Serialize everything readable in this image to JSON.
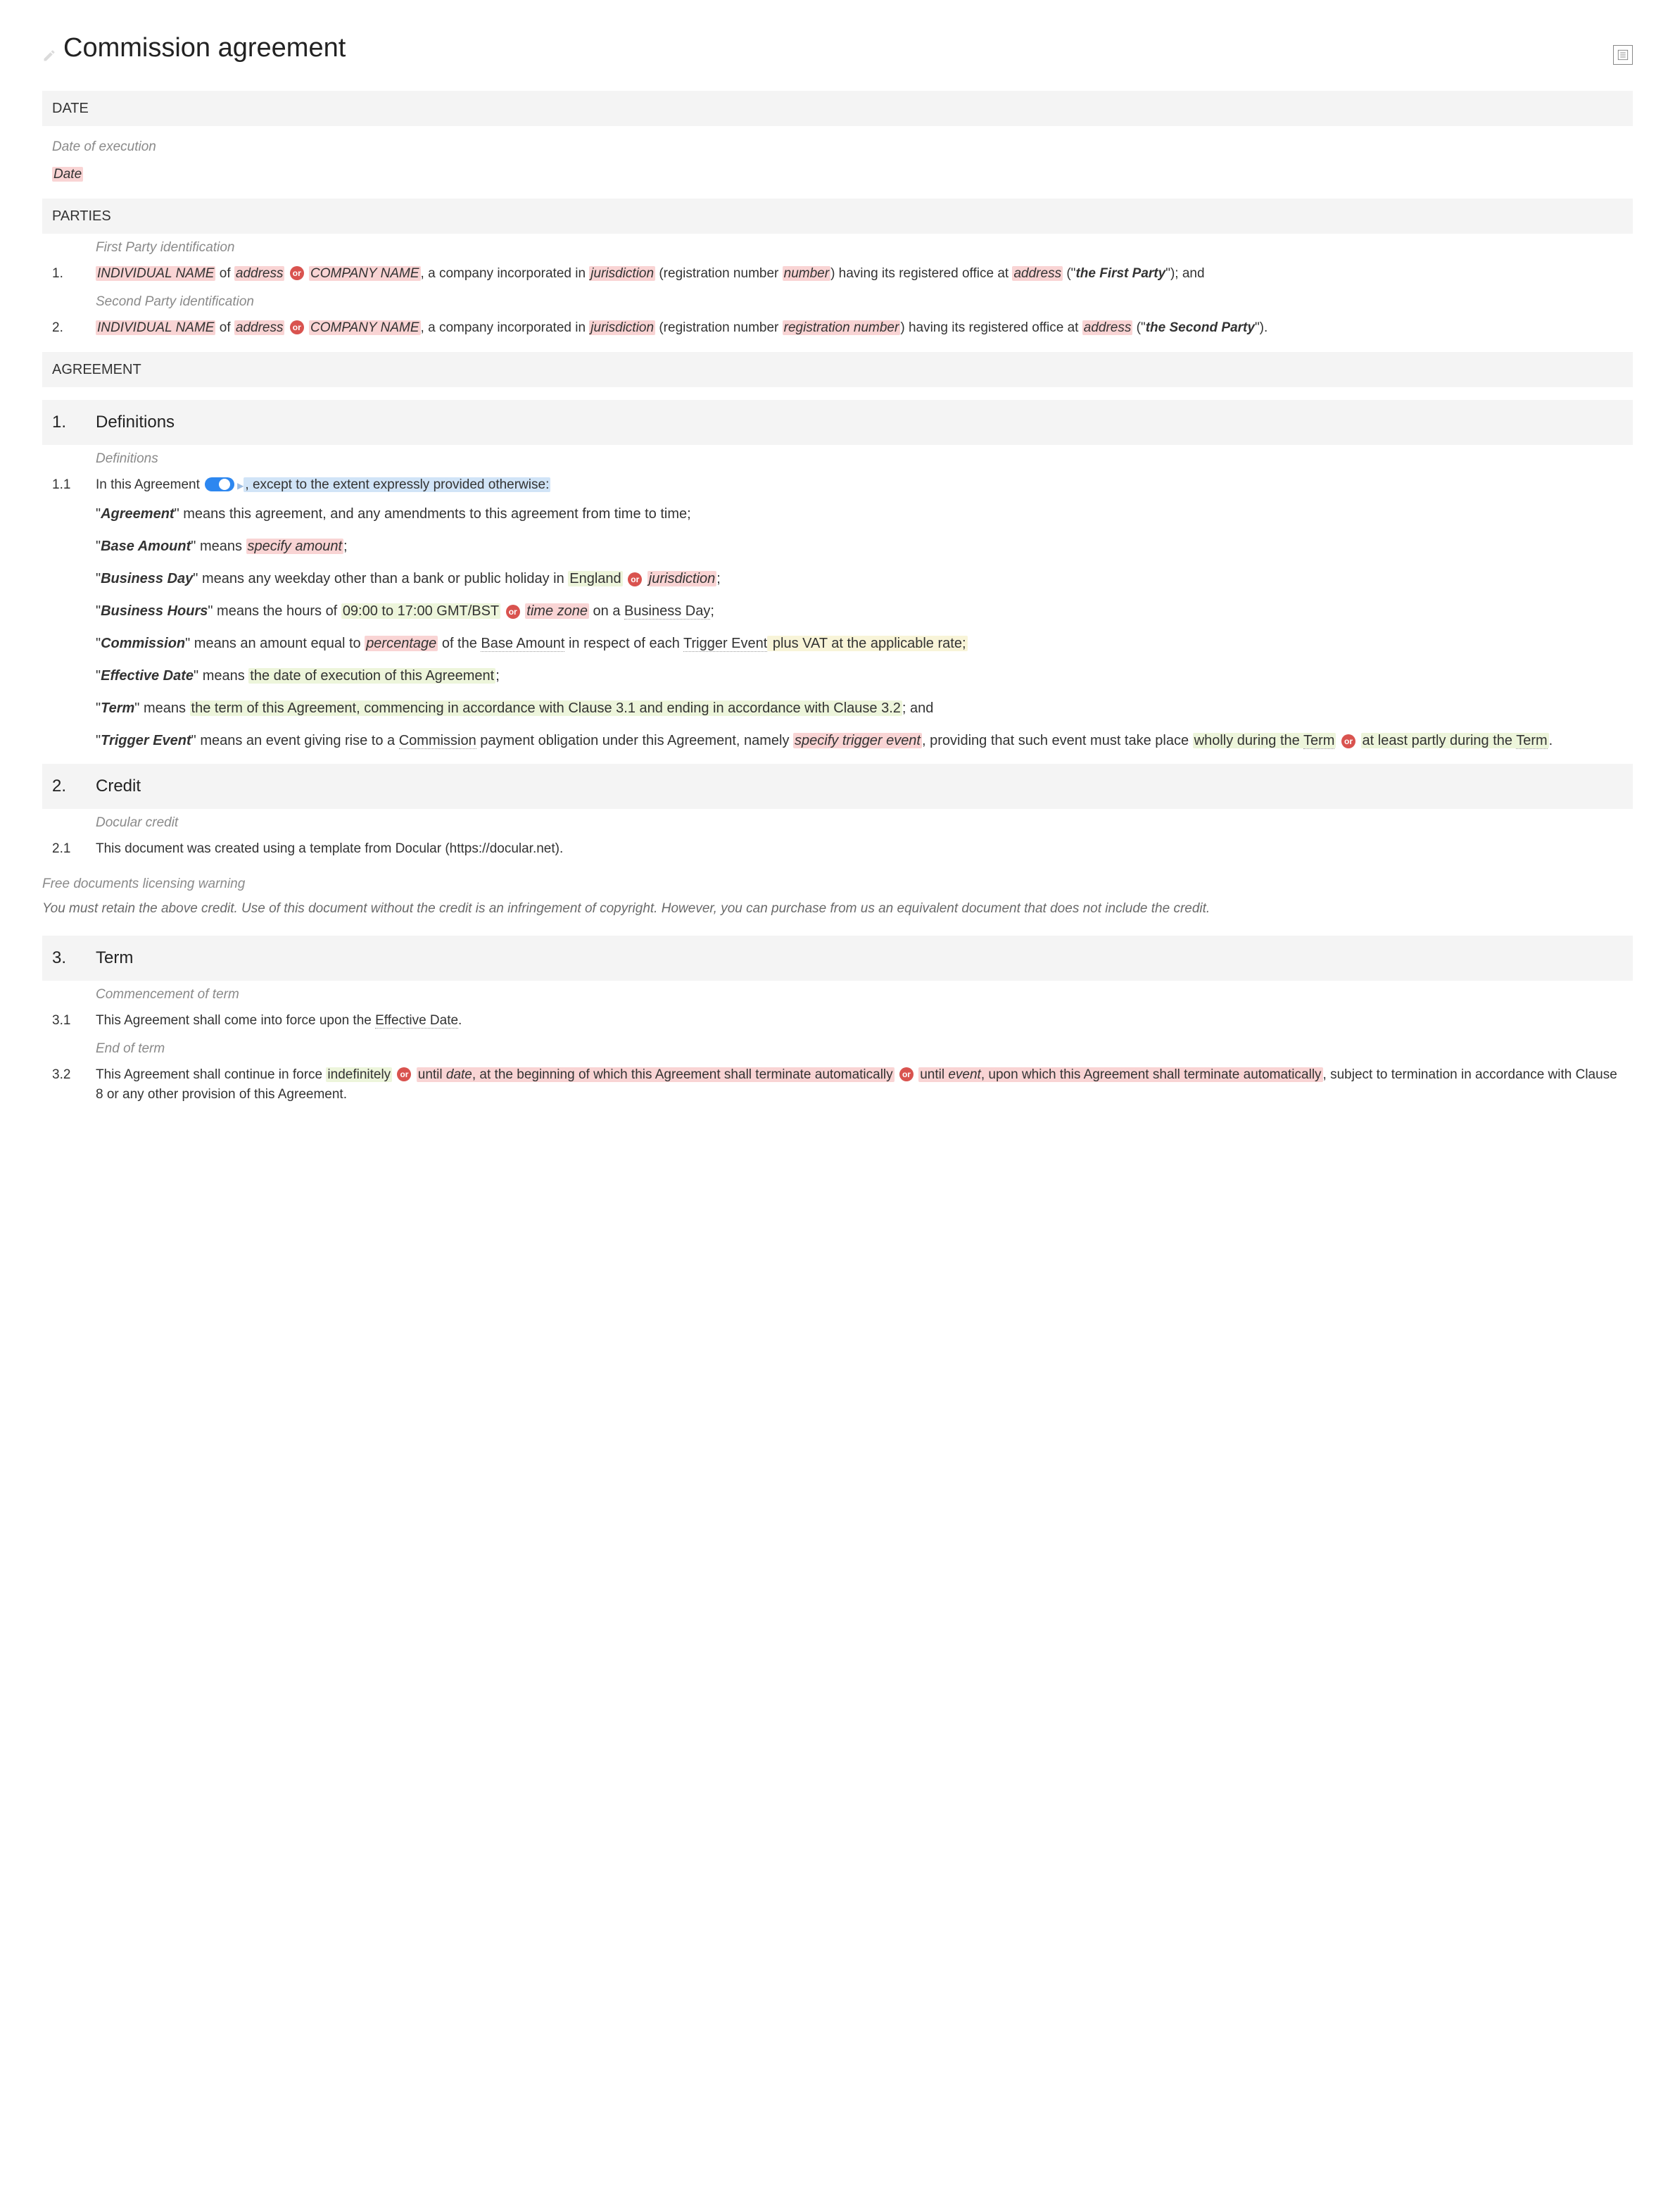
{
  "title": "Commission agreement",
  "sections": {
    "date_head": "DATE",
    "date_note": "Date of execution",
    "date_value": "Date",
    "parties_head": "PARTIES",
    "party1_note": "First Party identification",
    "party1_num": "1.",
    "party1": {
      "indiv": "INDIVIDUAL NAME",
      "of1": " of ",
      "addr1": "address",
      "or": "or",
      "co": "COMPANY NAME",
      "mid1": ", a company incorporated in ",
      "juris": "jurisdiction",
      "mid2": " (registration number ",
      "regnum": "number",
      "mid3": ") having its registered office at ",
      "addr2": "address",
      "mid4": " (\"",
      "label": "the First Party",
      "mid5": "\"); and"
    },
    "party2_note": "Second Party identification",
    "party2_num": "2.",
    "party2": {
      "indiv": "INDIVIDUAL NAME",
      "of1": " of ",
      "addr1": "address",
      "or": "or",
      "co": "COMPANY NAME",
      "mid1": ", a company incorporated in ",
      "juris": "jurisdiction",
      "mid2": " (registration number ",
      "regnum": "registration number",
      "mid3": ") having its registered office at ",
      "addr2": "address",
      "mid4": " (\"",
      "label": "the Second Party",
      "mid5": "\")."
    },
    "agreement_head": "AGREEMENT"
  },
  "clause1": {
    "num": "1.",
    "title": "Definitions",
    "defs_note": "Definitions",
    "subnum": "1.1",
    "intro_a": "In this Agreement",
    "intro_b": ", except to the extent expressly provided otherwise:",
    "agreement_def": "\" means this agreement, and any amendments to this agreement from time to time;",
    "agreement_t": "Agreement",
    "base_t": "Base Amount",
    "base_a": "\" means ",
    "base_amt": "specify amount",
    "base_b": ";",
    "bd_t": "Business Day",
    "bd_a": "\" means any weekday other than a bank or public holiday in ",
    "bd_eng": "England",
    "bd_or": "or",
    "bd_juris": "jurisdiction",
    "bd_b": ";",
    "bh_t": "Business Hours",
    "bh_a": "\" means the hours of ",
    "bh_hours": "09:00 to 17:00 GMT/BST",
    "bh_or": "or",
    "bh_tz": "time zone",
    "bh_b": " on a ",
    "bh_bd": "Business Day",
    "bh_c": ";",
    "comm_t": "Commission",
    "comm_a": "\" means an amount equal to ",
    "comm_pct": "percentage",
    "comm_b": " of the ",
    "comm_base": "Base Amount",
    "comm_c": " in respect of each ",
    "comm_trig": "Trigger Event",
    "comm_d": " plus VAT at the applicable rate;",
    "eff_t": "Effective Date",
    "eff_a": "\" means ",
    "eff_txt": "the date of execution of this Agreement",
    "eff_b": ";",
    "term_t": "Term",
    "term_a": "\" means ",
    "term_txt1": "the term of this Agreement, commencing in accordance with Clause 3.1 and ending in accordance with Clause 3.2",
    "term_b": "; and",
    "trig_t": "Trigger Event",
    "trig_a": "\" means an event giving rise to a ",
    "trig_comm": "Commission",
    "trig_b": " payment obligation under this Agreement, namely ",
    "trig_spec": "specify trigger event",
    "trig_c": ", providing that such event must take place ",
    "trig_opt1": "wholly during the ",
    "trig_termA": "Term",
    "trig_or": "or",
    "trig_opt2": "at least partly during the ",
    "trig_termB": "Term",
    "trig_d": "."
  },
  "clause2": {
    "num": "2.",
    "title": "Credit",
    "note": "Docular credit",
    "subnum": "2.1",
    "text": "This document was created using a template from Docular (https://docular.net).",
    "warn_head": "Free documents licensing warning",
    "warn_body": "You must retain the above credit. Use of this document without the credit is an infringement of copyright. However, you can purchase from us an equivalent document that does not include the credit."
  },
  "clause3": {
    "num": "3.",
    "title": "Term",
    "note1": "Commencement of term",
    "sub1_num": "3.1",
    "sub1_a": "This Agreement shall come into force upon the ",
    "sub1_eff": "Effective Date",
    "sub1_b": ".",
    "note2": "End of term",
    "sub2_num": "3.2",
    "sub2_a": "This Agreement shall continue in force ",
    "sub2_ind": "indefinitely",
    "sub2_or1": "or",
    "sub2_until1": "until ",
    "sub2_date": "date",
    "sub2_b": ", at the beginning of which this Agreement shall terminate automatically",
    "sub2_or2": "or",
    "sub2_until2": "until ",
    "sub2_event": "event",
    "sub2_c": ", upon which this Agreement shall terminate automatically",
    "sub2_d": ", subject to termination in accordance with Clause 8 or any other provision of this Agreement."
  }
}
